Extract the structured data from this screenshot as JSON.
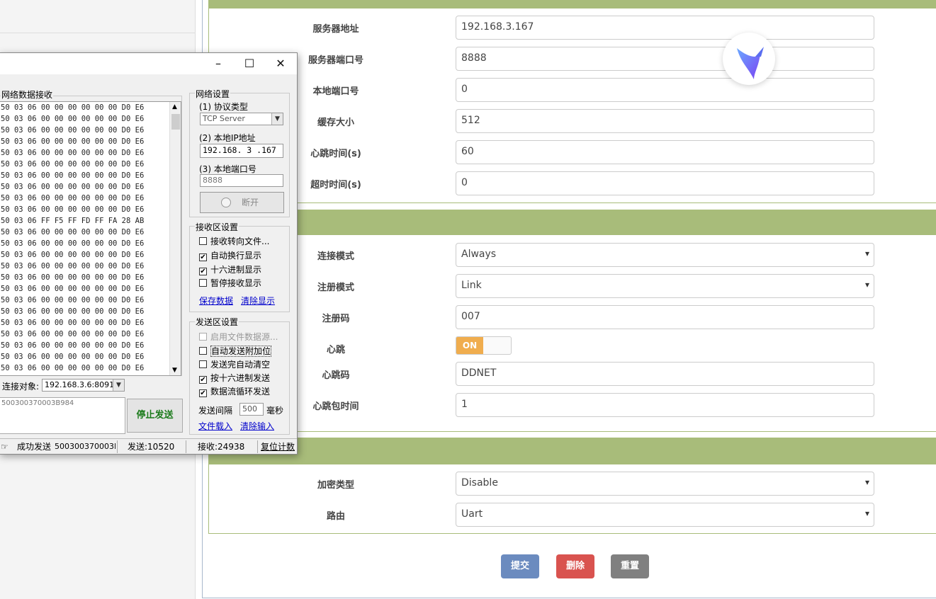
{
  "recv_panel": {
    "title": "网络数据接收",
    "lines": [
      "50 03 06 00 00 00 00 00 00 D0 E6",
      "50 03 06 00 00 00 00 00 00 D0 E6",
      "50 03 06 00 00 00 00 00 00 D0 E6",
      "50 03 06 00 00 00 00 00 00 D0 E6",
      "50 03 06 00 00 00 00 00 00 D0 E6",
      "50 03 06 00 00 00 00 00 00 D0 E6",
      "50 03 06 00 00 00 00 00 00 D0 E6",
      "50 03 06 00 00 00 00 00 00 D0 E6",
      "50 03 06 00 00 00 00 00 00 D0 E6",
      "50 03 06 00 00 00 00 00 00 D0 E6",
      "50 03 06 FF F5 FF FD FF FA 28 AB",
      "50 03 06 00 00 00 00 00 00 D0 E6",
      "50 03 06 00 00 00 00 00 00 D0 E6",
      "50 03 06 00 00 00 00 00 00 D0 E6",
      "50 03 06 00 00 00 00 00 00 D0 E6",
      "50 03 06 00 00 00 00 00 00 D0 E6",
      "50 03 06 00 00 00 00 00 00 D0 E6",
      "50 03 06 00 00 00 00 00 00 D0 E6",
      "50 03 06 00 00 00 00 00 00 D0 E6",
      "50 03 06 00 00 00 00 00 00 D0 E6",
      "50 03 06 00 00 00 00 00 00 D0 E6",
      "50 03 06 00 00 00 00 00 00 D0 E6",
      "50 03 06 00 00 00 00 00 00 D0 E6",
      "50 03 06 00 00 00 00 00 00 D0 E6"
    ]
  },
  "connect_target": {
    "label": "连接对象:",
    "value": "192.168.3.6:8091"
  },
  "send_box": {
    "value": "500300370003B984",
    "stop_label": "停止发送"
  },
  "net_settings": {
    "title": "网络设置",
    "protocol_label": "(1) 协议类型",
    "protocol_value": "TCP Server",
    "ip_label": "(2) 本地IP地址",
    "ip_value": "192.168. 3 .167",
    "port_label": "(3) 本地端口号",
    "port_value": "8888",
    "disconnect_label": "断开"
  },
  "recv_settings": {
    "title": "接收区设置",
    "options": [
      {
        "label": "接收转向文件...",
        "checked": ""
      },
      {
        "label": "自动换行显示",
        "checked": "✔"
      },
      {
        "label": "十六进制显示",
        "checked": "✔"
      },
      {
        "label": "暂停接收显示",
        "checked": ""
      }
    ],
    "save_link": "保存数据",
    "clear_link": "清除显示"
  },
  "send_settings": {
    "title": "发送区设置",
    "options": [
      {
        "label": "启用文件数据源...",
        "checked": ""
      },
      {
        "label": "自动发送附加位",
        "checked": ""
      },
      {
        "label": "发送完自动清空",
        "checked": ""
      },
      {
        "label": "按十六进制发送",
        "checked": "✔"
      },
      {
        "label": "数据流循环发送",
        "checked": "✔"
      }
    ],
    "interval_label": "发送间隔",
    "interval_value": "500",
    "interval_unit": "毫秒",
    "load_link": "文件载入",
    "clear_link": "清除输入"
  },
  "statusbar": {
    "sent_text": "成功发送",
    "sent_data": "500300370003B984",
    "send_count": "发送:10520",
    "recv_count": "接收:24938",
    "reset": "复位计数"
  },
  "form": {
    "server_address": {
      "label": "服务器地址",
      "value": "192.168.3.167"
    },
    "server_port": {
      "label": "服务器端口号",
      "value": "8888"
    },
    "local_port": {
      "label": "本地端口号",
      "value": "0"
    },
    "buffer_size": {
      "label": "缓存大小",
      "value": "512"
    },
    "heartbeat_time": {
      "label": "心跳时间(s)",
      "value": "60"
    },
    "timeout": {
      "label": "超时时间(s)",
      "value": "0"
    },
    "connect_mode": {
      "label": "连接模式",
      "value": "Always"
    },
    "register_mode": {
      "label": "注册模式",
      "value": "Link"
    },
    "register_code": {
      "label": "注册码",
      "value": "007"
    },
    "heartbeat": {
      "label": "心跳",
      "value": "ON"
    },
    "heartbeat_code": {
      "label": "心跳码",
      "value": "DDNET"
    },
    "heartbeat_packet_time": {
      "label": "心跳包时间",
      "value": "1"
    },
    "encrypt_type": {
      "label": "加密类型",
      "value": "Disable"
    },
    "route": {
      "label": "路由",
      "value": "Uart"
    }
  },
  "buttons": {
    "submit": "提交",
    "delete": "删除",
    "reset": "重置"
  },
  "colors": {
    "section_header": "#a8bc7a",
    "submit": "#6b8bbf",
    "delete": "#d9534f",
    "reset": "#808080",
    "toggle_on": "#f0ad4e"
  }
}
